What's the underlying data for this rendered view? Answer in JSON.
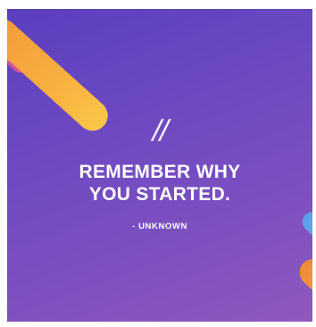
{
  "quote": {
    "mark": "//",
    "line1": "REMEMBER WHY",
    "line2": "YOU STARTED.",
    "author": "- UNKNOWN"
  },
  "colors": {
    "background_start": "#5a3fbf",
    "background_end": "#8f58bd",
    "accent_orange": "#f7b13f",
    "accent_pink": "#d8539a",
    "accent_blue": "#7ec0f5",
    "text": "#ffffff"
  }
}
